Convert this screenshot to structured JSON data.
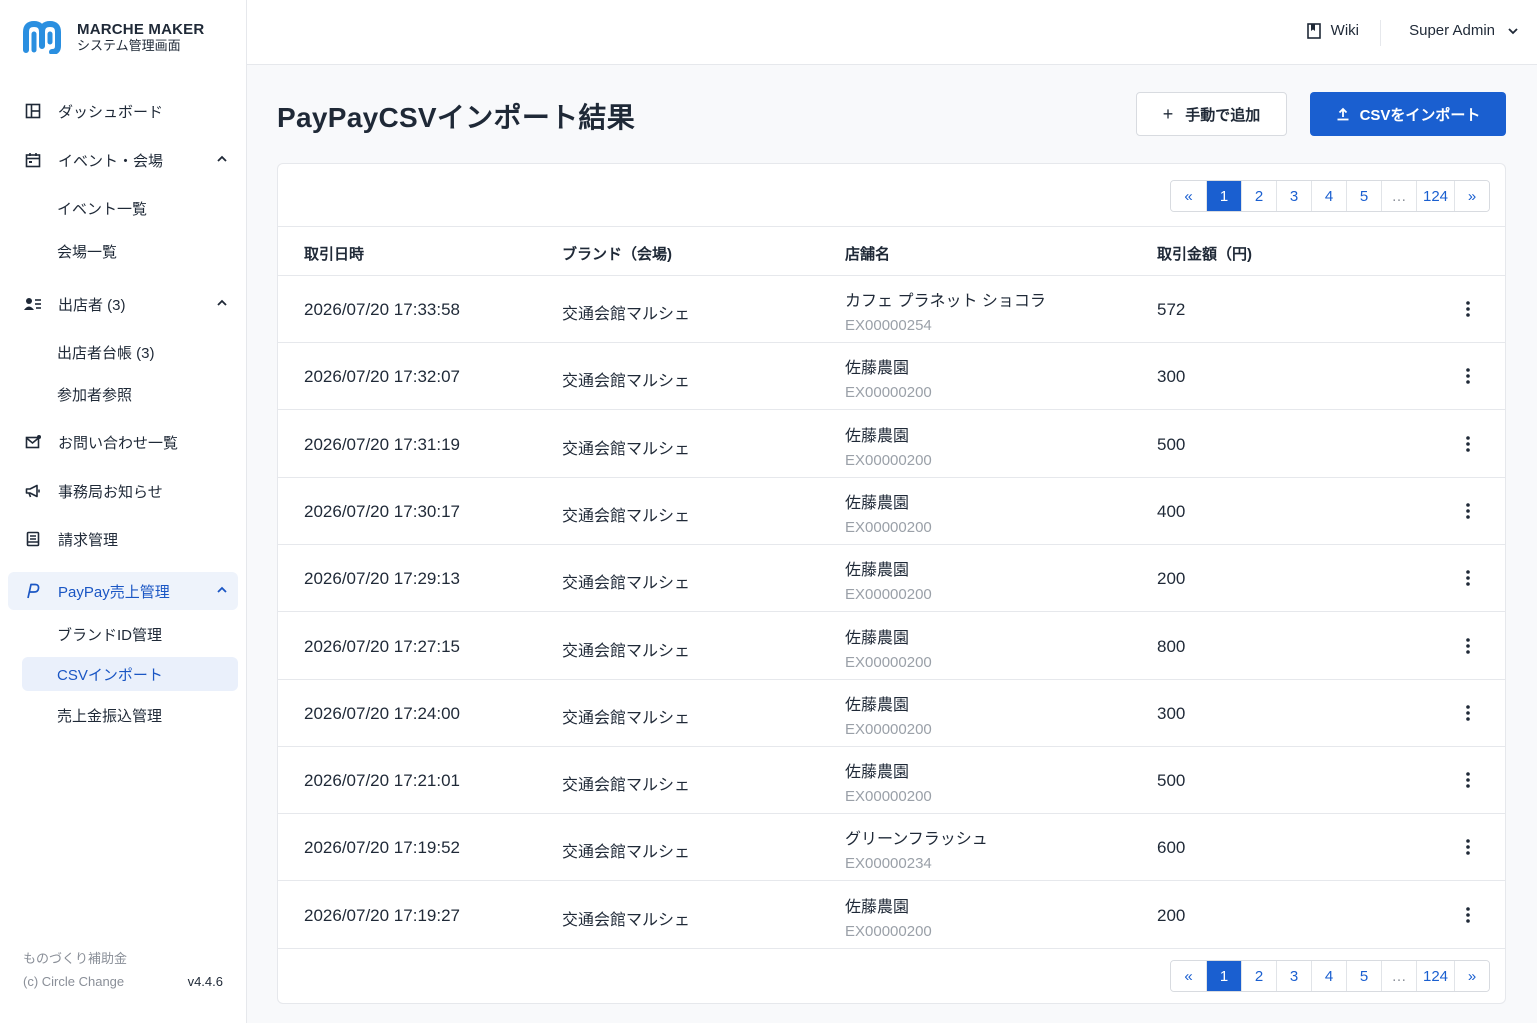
{
  "brand": {
    "name": "MARCHE MAKER",
    "subtitle": "システム管理画面"
  },
  "sidebar": {
    "dashboard": "ダッシュボード",
    "events": "イベント・会場",
    "events_list": "イベント一覧",
    "venues_list": "会場一覧",
    "exhibitors": "出店者 (3)",
    "exhibitor_ledger": "出店者台帳 (3)",
    "participant_ref": "参加者参照",
    "inquiries": "お問い合わせ一覧",
    "notices": "事務局お知らせ",
    "billing": "請求管理",
    "paypay": "PayPay売上管理",
    "brand_id": "ブランドID管理",
    "csv_import": "CSVインポート",
    "sales_transfer": "売上金振込管理"
  },
  "footer": {
    "subsidy": "ものづくり補助金",
    "copyright": "(c) Circle Change",
    "version": "v4.4.6"
  },
  "topbar": {
    "wiki": "Wiki",
    "user": "Super Admin"
  },
  "page": {
    "title": "PayPayCSVインポート結果",
    "manual_add": "手動で追加",
    "import_csv": "CSVをインポート"
  },
  "pagination": {
    "prev": "«",
    "pages": [
      "1",
      "2",
      "3",
      "4",
      "5"
    ],
    "dots": "…",
    "last": "124",
    "next": "»",
    "current": "1"
  },
  "table": {
    "headers": [
      "取引日時",
      "ブランド（会場)",
      "店舗名",
      "取引金額（円)"
    ],
    "rows": [
      {
        "date": "2026/07/20 17:33:58",
        "brand": "交通会館マルシェ",
        "store": "カフェ プラネット ショコラ",
        "store_id": "EX00000254",
        "amount": "572"
      },
      {
        "date": "2026/07/20 17:32:07",
        "brand": "交通会館マルシェ",
        "store": "佐藤農園",
        "store_id": "EX00000200",
        "amount": "300"
      },
      {
        "date": "2026/07/20 17:31:19",
        "brand": "交通会館マルシェ",
        "store": "佐藤農園",
        "store_id": "EX00000200",
        "amount": "500"
      },
      {
        "date": "2026/07/20 17:30:17",
        "brand": "交通会館マルシェ",
        "store": "佐藤農園",
        "store_id": "EX00000200",
        "amount": "400"
      },
      {
        "date": "2026/07/20 17:29:13",
        "brand": "交通会館マルシェ",
        "store": "佐藤農園",
        "store_id": "EX00000200",
        "amount": "200"
      },
      {
        "date": "2026/07/20 17:27:15",
        "brand": "交通会館マルシェ",
        "store": "佐藤農園",
        "store_id": "EX00000200",
        "amount": "800"
      },
      {
        "date": "2026/07/20 17:24:00",
        "brand": "交通会館マルシェ",
        "store": "佐藤農園",
        "store_id": "EX00000200",
        "amount": "300"
      },
      {
        "date": "2026/07/20 17:21:01",
        "brand": "交通会館マルシェ",
        "store": "佐藤農園",
        "store_id": "EX00000200",
        "amount": "500"
      },
      {
        "date": "2026/07/20 17:19:52",
        "brand": "交通会館マルシェ",
        "store": "グリーンフラッシュ",
        "store_id": "EX00000234",
        "amount": "600"
      },
      {
        "date": "2026/07/20 17:19:27",
        "brand": "交通会館マルシェ",
        "store": "佐藤農園",
        "store_id": "EX00000200",
        "amount": "200"
      }
    ]
  },
  "colors": {
    "accent": "#1a5fd0",
    "active_bg": "#eaf0fb",
    "text": "#1f2937",
    "muted": "#9aa0a8"
  },
  "icons": {
    "dashboard": "dashboard-icon",
    "events": "calendar-icon",
    "exhibitors": "users-list-icon",
    "inquiries": "mail-icon",
    "notices": "megaphone-icon",
    "billing": "receipt-icon",
    "paypay": "paypay-icon",
    "wiki": "book-icon",
    "row_menu": "kebab-menu-icon"
  }
}
